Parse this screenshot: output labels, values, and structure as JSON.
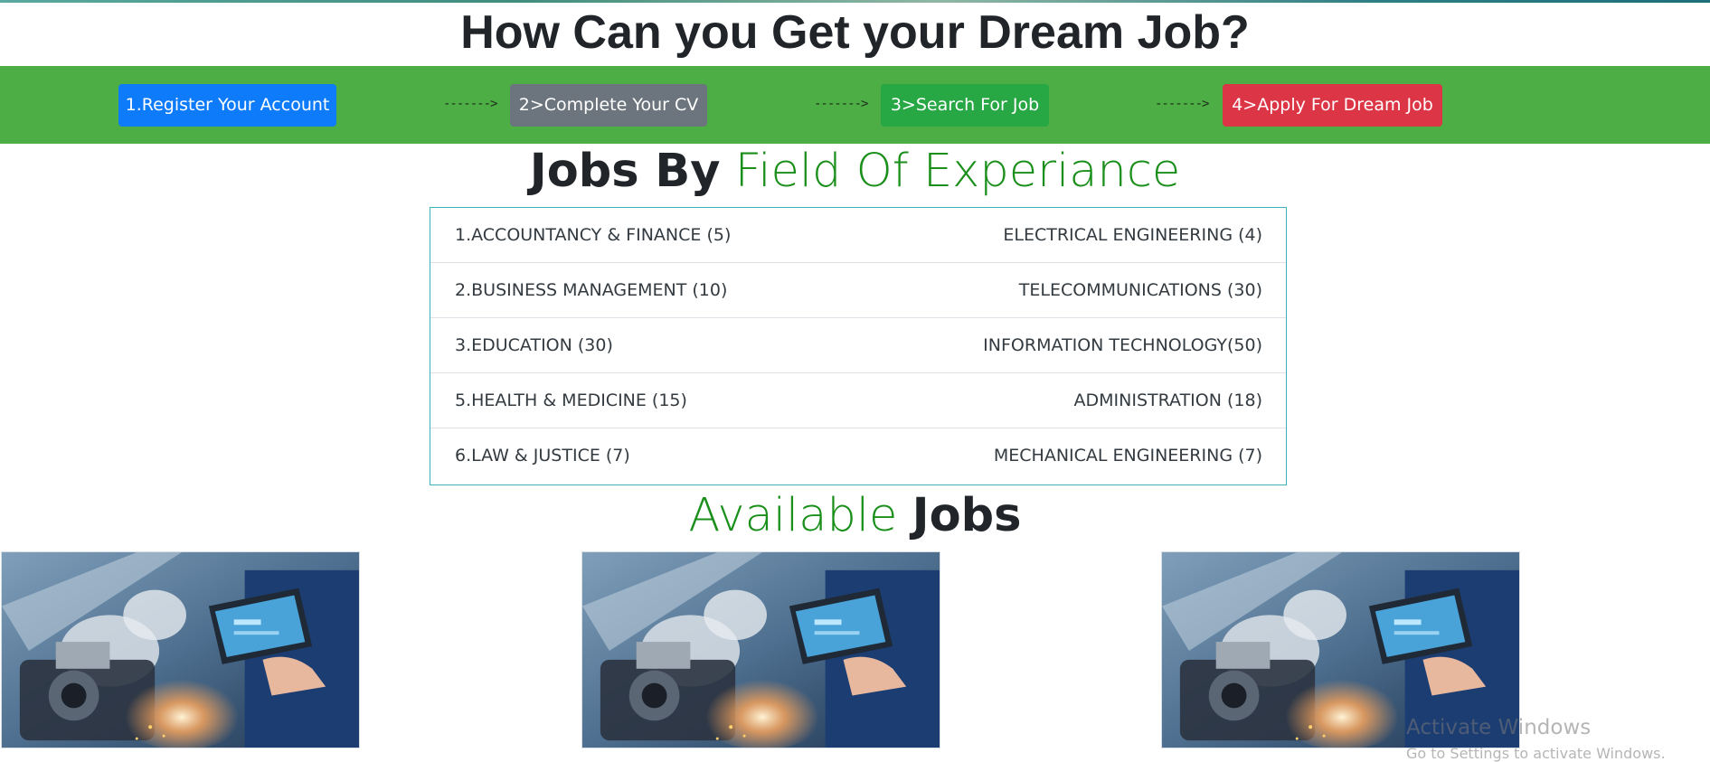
{
  "header": {
    "title": "How Can you Get your Dream Job?"
  },
  "steps": {
    "items": [
      {
        "label": "1.Register Your Account",
        "color": "#0d7bfa"
      },
      {
        "label": "2>Complete Your CV",
        "color": "#6c757d"
      },
      {
        "label": "3>Search For Job",
        "color": "#28a745"
      },
      {
        "label": "4>Apply For Dream Job",
        "color": "#dc3545"
      }
    ],
    "arrow": "------->",
    "bar_color": "#4cae44"
  },
  "jobs_by_field": {
    "title_bold": "Jobs By",
    "title_green": "Field Of Experiance",
    "rows": [
      {
        "left": "1.ACCOUNTANCY & FINANCE (5)",
        "right": "ELECTRICAL ENGINEERING (4)"
      },
      {
        "left": "2.BUSINESS MANAGEMENT (10)",
        "right": "TELECOMMUNICATIONS (30)"
      },
      {
        "left": "3.EDUCATION (30)",
        "right": "INFORMATION TECHNOLOGY(50)"
      },
      {
        "left": "5.HEALTH & MEDICINE (15)",
        "right": "ADMINISTRATION (18)"
      },
      {
        "left": "6.LAW & JUSTICE (7)",
        "right": "MECHANICAL ENGINEERING (7)"
      }
    ]
  },
  "available_jobs": {
    "title_green": "Available",
    "title_bold": "Jobs",
    "cards": [
      {
        "image": "industrial-robot-tablet-photo"
      },
      {
        "image": "industrial-robot-tablet-photo"
      },
      {
        "image": "industrial-robot-tablet-photo"
      }
    ]
  },
  "watermark": {
    "line1": "Activate Windows",
    "line2": "Go to Settings to activate Windows."
  }
}
